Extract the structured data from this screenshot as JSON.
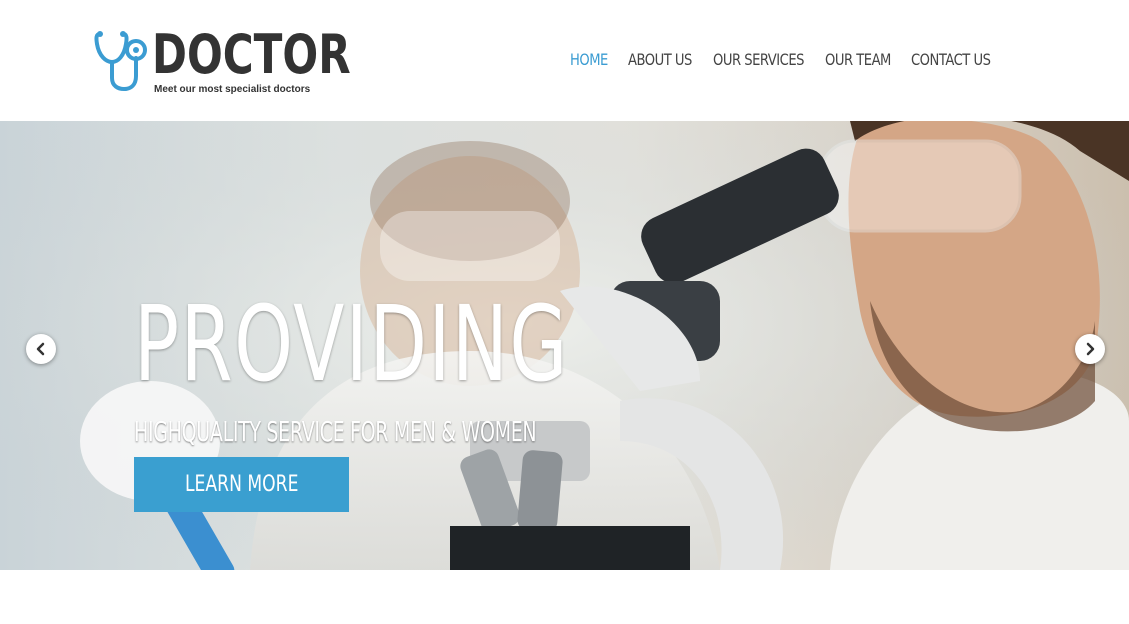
{
  "brand": {
    "name": "DOCTOR",
    "tagline": "Meet our most specialist doctors",
    "icon": "stethoscope-icon",
    "accent_color": "#3b9cd2"
  },
  "nav": {
    "items": [
      {
        "label": "HOME",
        "active": true
      },
      {
        "label": "ABOUT US",
        "active": false
      },
      {
        "label": "OUR SERVICES",
        "active": false
      },
      {
        "label": "OUR TEAM",
        "active": false
      },
      {
        "label": "CONTACT US",
        "active": false
      }
    ]
  },
  "hero": {
    "title": "PROVIDING",
    "subtitle": "HIGHQUALITY SERVICE FOR MEN & WOMEN",
    "button_label": "LEARN MORE",
    "button_color": "#3a9fd0",
    "prev_icon": "chevron-left-icon",
    "next_icon": "chevron-right-icon"
  }
}
